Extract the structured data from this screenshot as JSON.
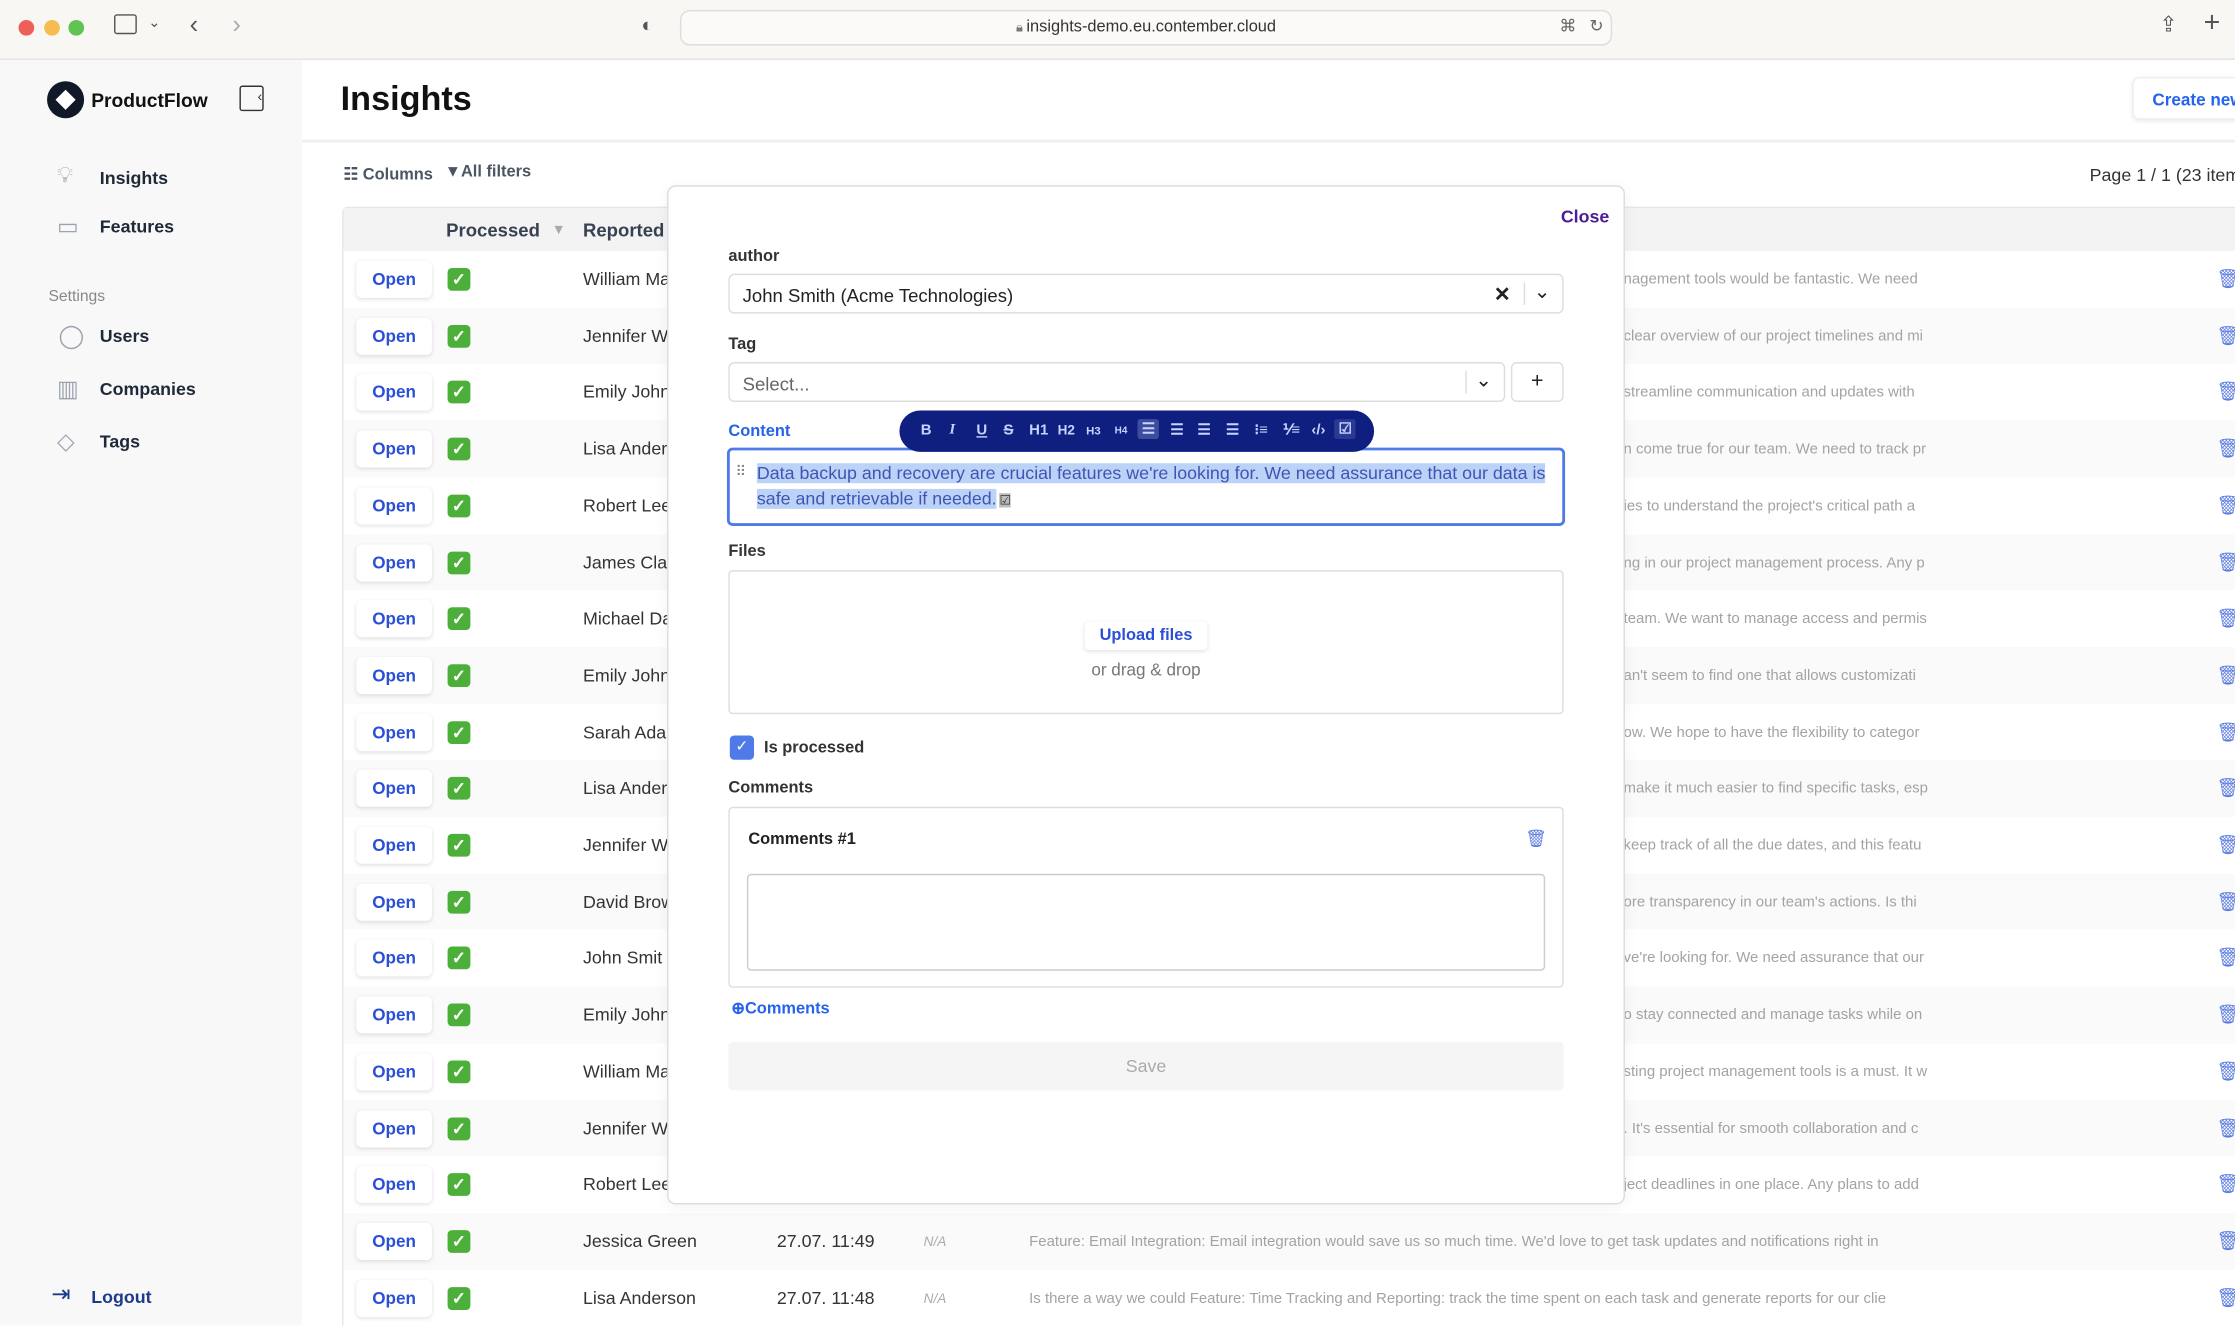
{
  "browser": {
    "url": "insights-demo.eu.contember.cloud"
  },
  "sidebar": {
    "brand": "ProductFlow",
    "items": [
      {
        "label": "Insights",
        "icon": "lightbulb-icon"
      },
      {
        "label": "Features",
        "icon": "chat-icon"
      }
    ],
    "settings_heading": "Settings",
    "settings_items": [
      {
        "label": "Users",
        "icon": "user-icon"
      },
      {
        "label": "Companies",
        "icon": "building-icon"
      },
      {
        "label": "Tags",
        "icon": "tag-icon"
      }
    ],
    "logout": "Logout"
  },
  "header": {
    "title": "Insights",
    "create_button": "Create new"
  },
  "toolbar": {
    "columns": "Columns",
    "filters": "All filters",
    "page_info": "Page 1 / 1 (23 item"
  },
  "table": {
    "headers": {
      "processed": "Processed",
      "reported": "Reported"
    },
    "open_label": "Open",
    "rows": [
      {
        "name": "William Ma",
        "date": "",
        "na": "",
        "content": "nagement tools would be fantastic. We need"
      },
      {
        "name": "Jennifer W",
        "date": "",
        "na": "",
        "content": "clear overview of our project timelines and mi"
      },
      {
        "name": "Emily John",
        "date": "",
        "na": "",
        "content": "streamline communication and updates with"
      },
      {
        "name": "Lisa Ander",
        "date": "",
        "na": "",
        "content": "n come true for our team. We need to track pr"
      },
      {
        "name": "Robert Lee",
        "date": "",
        "na": "",
        "content": "ies to understand the project's critical path a"
      },
      {
        "name": "James Cla",
        "date": "",
        "na": "",
        "content": "ng in our project management process. Any p"
      },
      {
        "name": "Michael Da",
        "date": "",
        "na": "",
        "content": "team. We want to manage access and permis"
      },
      {
        "name": "Emily John",
        "date": "",
        "na": "",
        "content": "an't seem to find one that allows customizati"
      },
      {
        "name": "Sarah Ada",
        "date": "",
        "na": "",
        "content": "ow. We hope to have the flexibility to categor"
      },
      {
        "name": "Lisa Ander",
        "date": "",
        "na": "",
        "content": "make it much easier to find specific tasks, esp"
      },
      {
        "name": "Jennifer W",
        "date": "",
        "na": "",
        "content": "keep track of all the due dates, and this featu"
      },
      {
        "name": "David Brow",
        "date": "",
        "na": "",
        "content": "ore transparency in our team's actions. Is thi"
      },
      {
        "name": "John Smit",
        "date": "",
        "na": "",
        "content": "ve're looking for. We need assurance that our"
      },
      {
        "name": "Emily John",
        "date": "",
        "na": "",
        "content": "o stay connected and manage tasks while on"
      },
      {
        "name": "William Ma",
        "date": "",
        "na": "",
        "content": "sting project management tools is a must. It w"
      },
      {
        "name": "Jennifer W",
        "date": "",
        "na": "",
        "content": ". It's essential for smooth collaboration and c"
      },
      {
        "name": "Robert Lee",
        "date": "",
        "na": "",
        "content": "ject deadlines in one place. Any plans to add"
      },
      {
        "name": "Jessica Green",
        "date": "27.07. 11:49",
        "na": "N/A",
        "content": "Feature: Email Integration: Email integration would save us so much time. We'd love to get task updates and notifications right in"
      },
      {
        "name": "Lisa Anderson",
        "date": "27.07. 11:48",
        "na": "N/A",
        "content": "Is there a way we could Feature: Time Tracking and Reporting: track the time spent on each task and generate reports for our clie"
      }
    ]
  },
  "modal": {
    "close": "Close",
    "author_label": "author",
    "author_value": "John Smith (Acme Technologies)",
    "tag_label": "Tag",
    "tag_placeholder": "Select...",
    "content_label": "Content",
    "format_toolbar": [
      "B",
      "I",
      "U",
      "S",
      "H1",
      "H2",
      "H3",
      "H4",
      "align-left",
      "align-center",
      "align-right",
      "justify",
      "bullet-list",
      "ordered-list",
      "code",
      "task-list"
    ],
    "content_text": "Data backup and recovery are crucial features we're looking for. We need assurance that our data is safe and retrievable if needed.",
    "files_label": "Files",
    "upload_button": "Upload files",
    "drag_text": "or drag & drop",
    "is_processed_label": "Is processed",
    "is_processed": true,
    "comments_label": "Comments",
    "comment_title": "Comments #1",
    "add_comment": "Comments",
    "save": "Save"
  },
  "colors": {
    "accent": "#2b50d8",
    "toolbar": "#0e1f80",
    "close": "#4c1d95",
    "check": "#4caf3a"
  }
}
